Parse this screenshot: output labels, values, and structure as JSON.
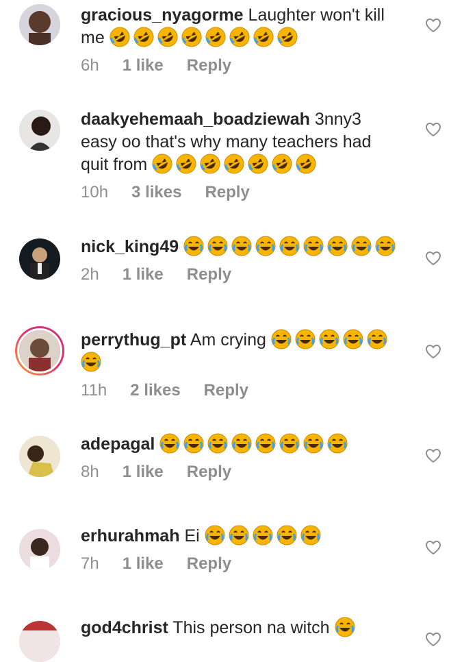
{
  "comments": [
    {
      "username": "gracious_nyagorme",
      "text": "Laughter won't kill me",
      "emoji_type": "rofl",
      "emoji_count": 8,
      "time": "6h",
      "likes": "1 like",
      "reply": "Reply",
      "avatar_color": "#5a3a2c"
    },
    {
      "username": "daakyehemaah_boadziewah",
      "text": "3nny3 easy oo that's why many teachers had quit from",
      "emoji_type": "rofl",
      "emoji_count": 7,
      "time": "10h",
      "likes": "3 likes",
      "reply": "Reply",
      "avatar_color": "#2a1a14"
    },
    {
      "username": "nick_king49",
      "text": "",
      "emoji_type": "joy",
      "emoji_count": 9,
      "time": "2h",
      "likes": "1 like",
      "reply": "Reply",
      "avatar_color": "#1f2b33"
    },
    {
      "username": "perrythug_pt",
      "text": "Am crying",
      "emoji_type": "joy",
      "emoji_count": 6,
      "time": "11h",
      "likes": "2 likes",
      "reply": "Reply",
      "avatar_color": "#6b4b3a"
    },
    {
      "username": "adepagal",
      "text": "",
      "emoji_type": "joy",
      "emoji_count": 8,
      "time": "8h",
      "likes": "1 like",
      "reply": "Reply",
      "avatar_color": "#c9b27a"
    },
    {
      "username": "erhurahmah",
      "text": "Ei",
      "emoji_type": "joy",
      "emoji_count": 5,
      "time": "7h",
      "likes": "1 like",
      "reply": "Reply",
      "avatar_color": "#3a2820"
    },
    {
      "username": "god4christ",
      "text": "This person na witch",
      "emoji_type": "joy",
      "emoji_count": 1,
      "time": "",
      "likes": "",
      "reply": "",
      "avatar_color": "#b33"
    }
  ],
  "icons": {
    "like": "heart-outline-icon"
  },
  "colors": {
    "meta": "#8e8e8e",
    "text": "#262626",
    "emoji": "#f7b500"
  }
}
